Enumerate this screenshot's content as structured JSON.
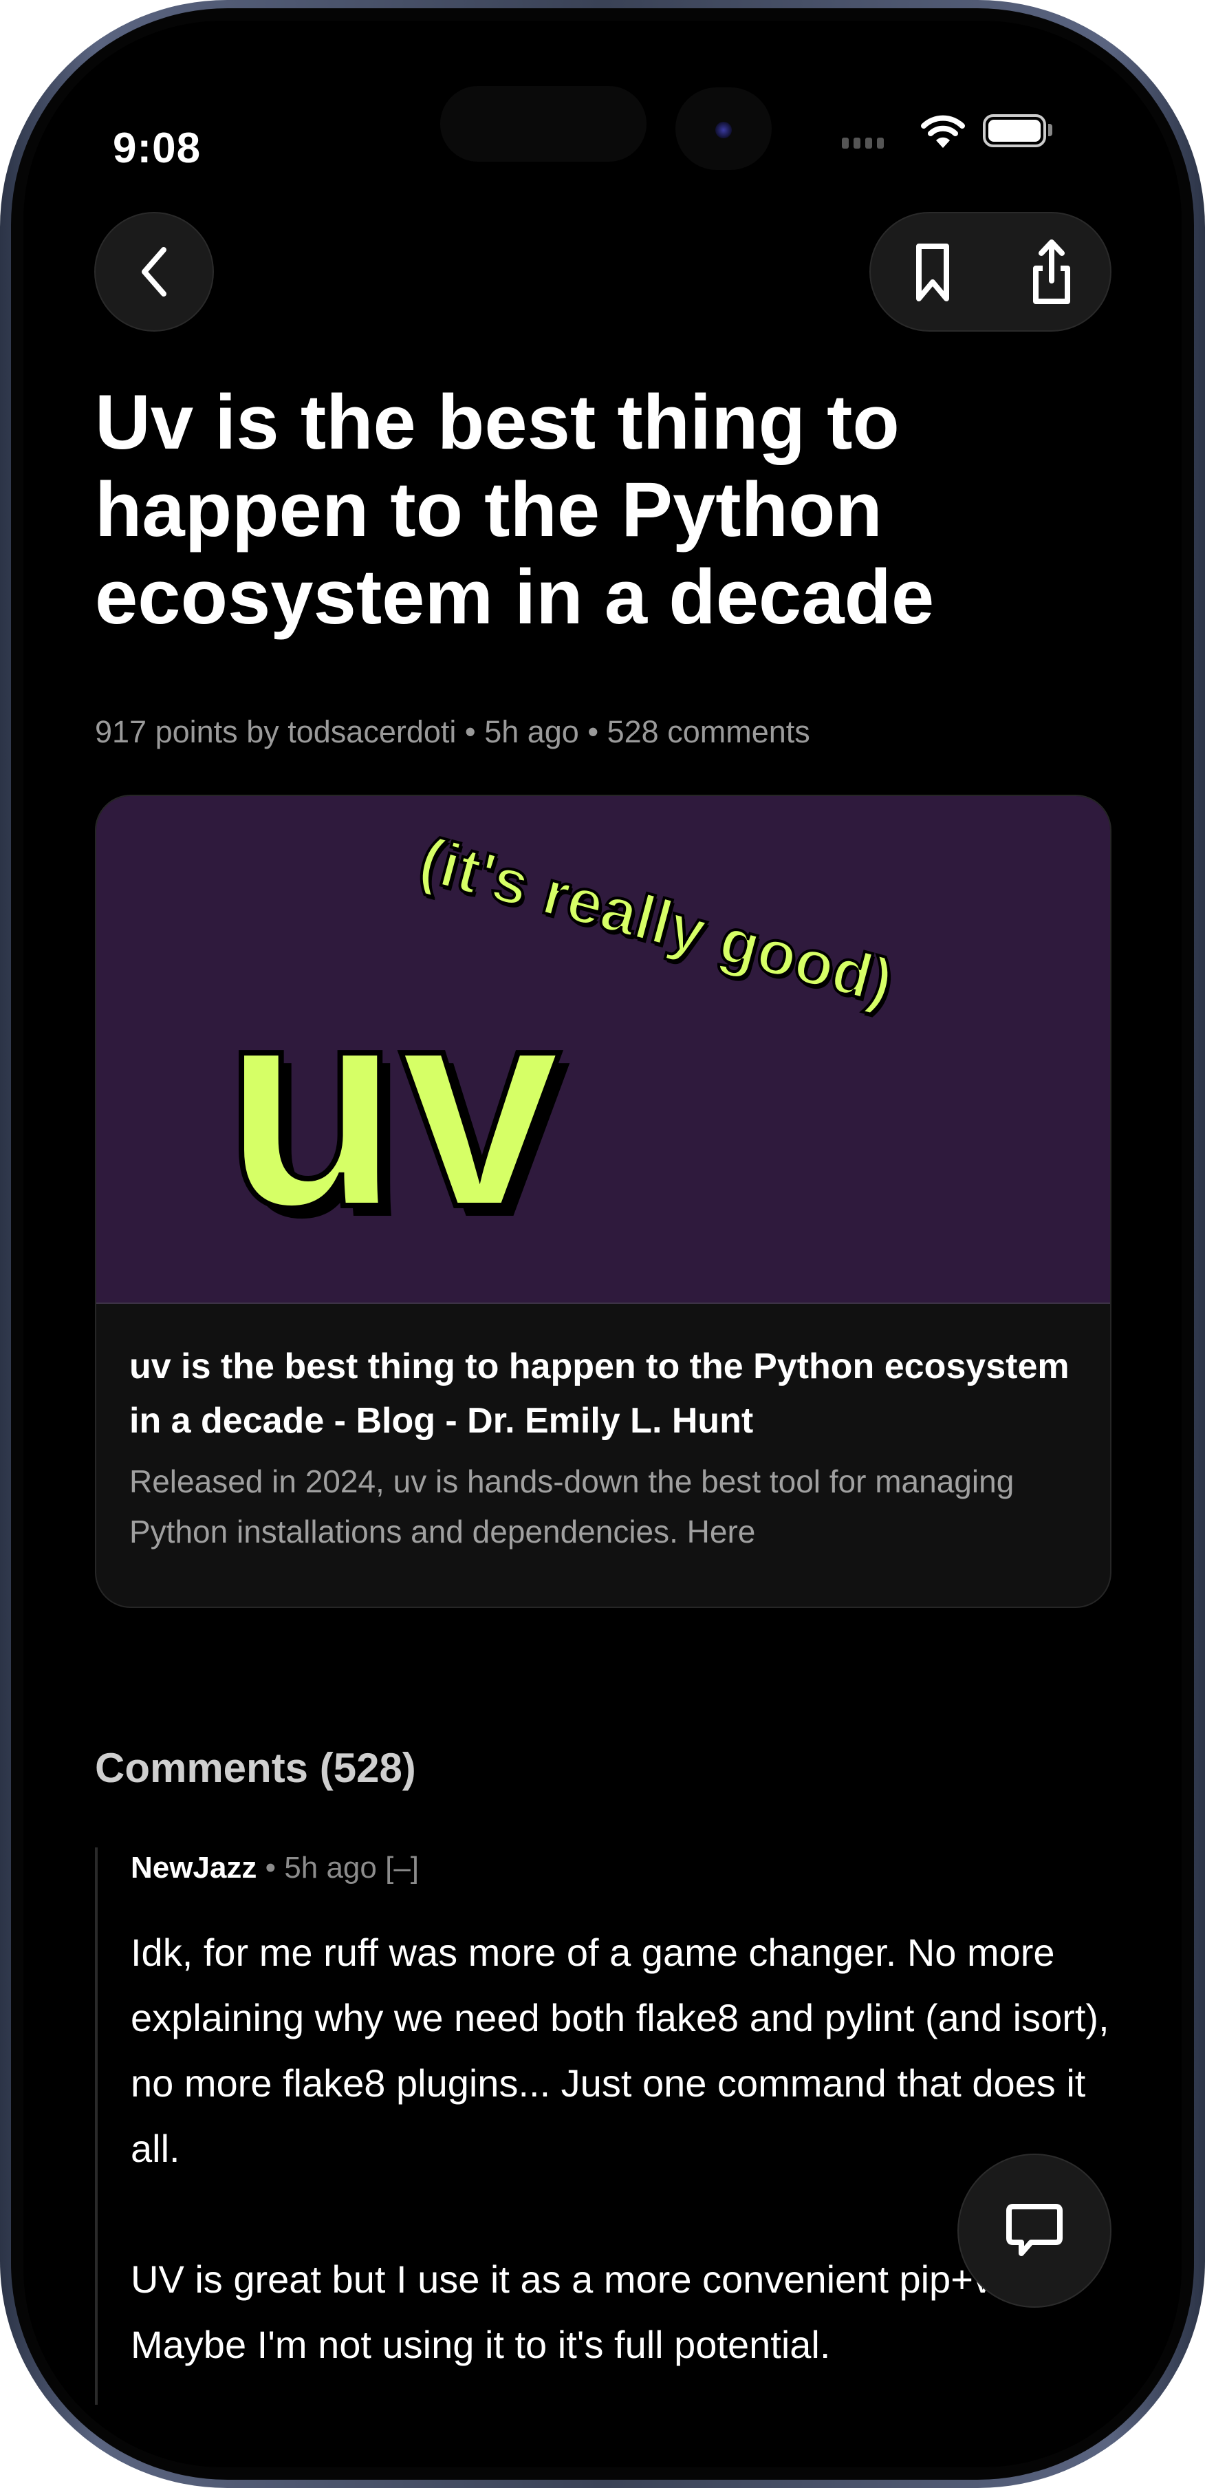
{
  "status_bar": {
    "time": "9:08",
    "icons": [
      "signal-icon",
      "wifi-icon",
      "battery-icon"
    ]
  },
  "toolbar": {
    "back_icon": "chevron-left-icon",
    "bookmark_icon": "bookmark-icon",
    "share_icon": "share-icon"
  },
  "story": {
    "title": "Uv is the best thing to happen to the Python ecosystem in a decade",
    "points": "917 points",
    "by": "by",
    "author": "todsacerdoti",
    "sep": "•",
    "age": "5h ago",
    "comments": "528 comments"
  },
  "link_card": {
    "image_text_main": "uv",
    "image_text_tag": "(it's really good)",
    "title": "uv is the best thing to happen to the Python ecosystem in a decade - Blog - Dr. Emily L. Hunt",
    "description": "Released in 2024, uv is hands-down the best tool for managing Python installations and dependencies. Here",
    "colors": {
      "image_bg": "#2f1a3d",
      "accent": "#d6ff66"
    }
  },
  "comments_section": {
    "heading": "Comments (528)",
    "items": [
      {
        "author": "NewJazz",
        "sep": "•",
        "age": "5h ago",
        "collapse": "[–]",
        "paragraphs": [
          "Idk, for me ruff was more of a game changer. No more explaining why we need both flake8 and pylint (and isort), no more flake8 plugins... Just one command that does it all.",
          "UV is great but I use it as a more convenient pip+venv. Maybe I'm not using it to it's full potential."
        ]
      }
    ]
  },
  "fab": {
    "icon": "comment-icon"
  }
}
